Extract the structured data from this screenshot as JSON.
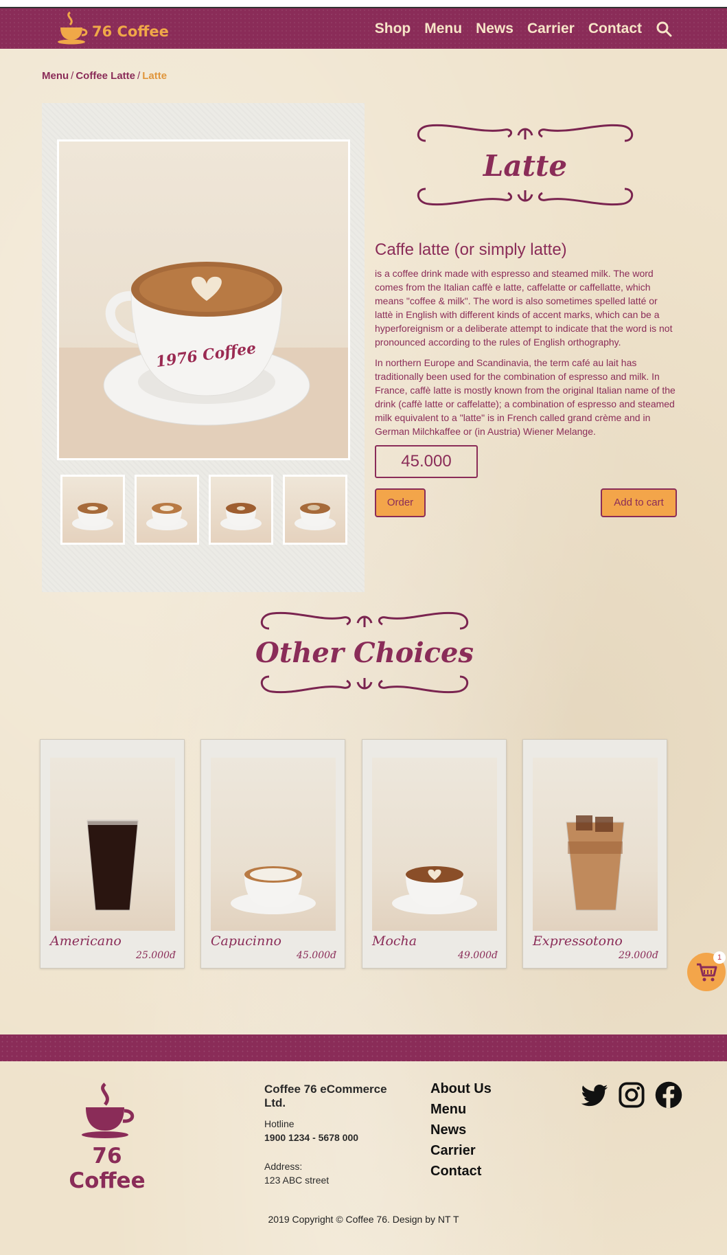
{
  "header": {
    "brand": "76 Coffee",
    "nav": [
      "Shop",
      "Menu",
      "News",
      "Carrier",
      "Contact"
    ]
  },
  "breadcrumb": {
    "items": [
      "Menu",
      "Coffee Latte",
      "Latte"
    ],
    "separator": "/"
  },
  "product": {
    "name": "Latte",
    "heading": "Caffe latte (or simply latte)",
    "paragraphs": [
      "is a coffee drink made with espresso and steamed milk. The word comes from the Italian caffè e latte, caffelatte or caffellatte, which means \"coffee & milk\". The word is also sometimes spelled latté or lattè in English with different kinds of accent marks, which can be a hyperforeignism or a deliberate attempt to indicate that the word is not pronounced according to the rules of English orthography.",
      "In northern Europe and Scandinavia, the term café au lait has traditionally been used for the combination of espresso and milk. In France, caffè latte is mostly known from the original Italian name of the drink (caffè latte or caffelatte); a combination of espresso and steamed milk equivalent to a \"latte\" is in French called grand crème and in German Milchkaffee or (in Austria) Wiener Melange."
    ],
    "price": "45.000",
    "cup_text": "1976 Coffee",
    "order_label": "Order",
    "cart_label": "Add to cart"
  },
  "other": {
    "title": "Other Choices",
    "items": [
      {
        "name": "Americano",
        "price": "25.000đ"
      },
      {
        "name": "Capucinno",
        "price": "45.000đ"
      },
      {
        "name": "Mocha",
        "price": "49.000đ"
      },
      {
        "name": "Expressotono",
        "price": "29.000đ"
      }
    ]
  },
  "cart": {
    "count": "1"
  },
  "footer": {
    "brand": "76 Coffee",
    "company": "Coffee 76 eCommerce Ltd.",
    "hotline_label": "Hotline",
    "hotline": "1900 1234 - 5678 000",
    "address_label": "Address:",
    "address": "123 ABC street",
    "links": [
      "About Us",
      "Menu",
      "News",
      "Carrier",
      "Contact"
    ],
    "copyright": "2019 Copyright © Coffee 76. Design by NT T"
  },
  "colors": {
    "brand": "#8a2c58",
    "accent": "#f3a54a",
    "background": "#efe3cc"
  },
  "icons": [
    "cup-logo-icon",
    "search-icon",
    "cart-icon",
    "twitter-icon",
    "instagram-icon",
    "facebook-icon",
    "ornament-frame"
  ]
}
